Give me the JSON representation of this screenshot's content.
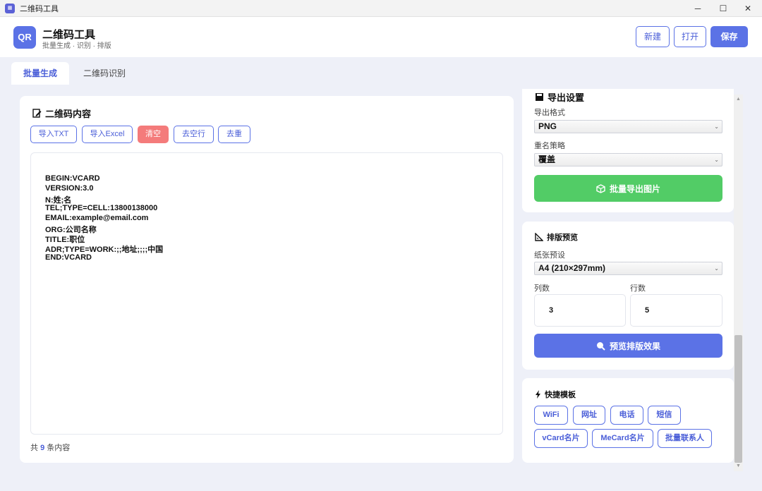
{
  "window": {
    "title": "二维码工具",
    "icon": "qr-app-icon",
    "controls": [
      "─",
      "☐",
      "✕"
    ]
  },
  "header": {
    "logo_text": "QR",
    "title": "二维码工具",
    "subtitle": "批量生成 · 识别 · 排版",
    "buttons": {
      "new": "新建",
      "open": "打开",
      "save": "保存"
    }
  },
  "tabs": [
    {
      "label": "批量生成",
      "active": true
    },
    {
      "label": "二维码识别",
      "active": false
    }
  ],
  "content_card": {
    "title": "二维码内容",
    "title_icon": "edit-icon",
    "buttons": {
      "import_txt": "导入TXT",
      "import_excel": "导入Excel",
      "clear": "清空",
      "remove_blank": "去空行",
      "dedupe": "去重"
    },
    "lines": [
      "BEGIN:VCARD",
      "VERSION:3.0",
      "N:姓;名",
      "TEL;TYPE=CELL:13800138000",
      "EMAIL:example@email.com",
      "ORG:公司名称",
      "TITLE:职位",
      "ADR;TYPE=WORK:;;地址;;;;中国",
      "END:VCARD"
    ],
    "count_prefix": "共",
    "count": "9",
    "count_suffix": "条内容"
  },
  "export_card": {
    "title": "导出设置",
    "title_icon": "save-icon",
    "format_label": "导出格式",
    "format_value": "PNG",
    "rename_label": "重名策略",
    "rename_value": "覆盖",
    "export_button": "批量导出图片",
    "export_icon": "cube-icon"
  },
  "layout_card": {
    "title": "排版预览",
    "title_icon": "ruler-icon",
    "paper_label": "纸张预设",
    "paper_value": "A4 (210×297mm)",
    "cols_label": "列数",
    "cols_value": "3",
    "rows_label": "行数",
    "rows_value": "5",
    "preview_button": "预览排版效果",
    "preview_icon": "magnifier-icon"
  },
  "templates_card": {
    "title": "快捷模板",
    "title_icon": "bolt-icon",
    "chips": [
      "WiFi",
      "网址",
      "电话",
      "短信",
      "vCard名片",
      "MeCard名片",
      "批量联系人"
    ]
  },
  "colors": {
    "accent": "#5b72e6",
    "success": "#52cc66",
    "danger": "#f47b7b",
    "background": "#eef0f8"
  }
}
